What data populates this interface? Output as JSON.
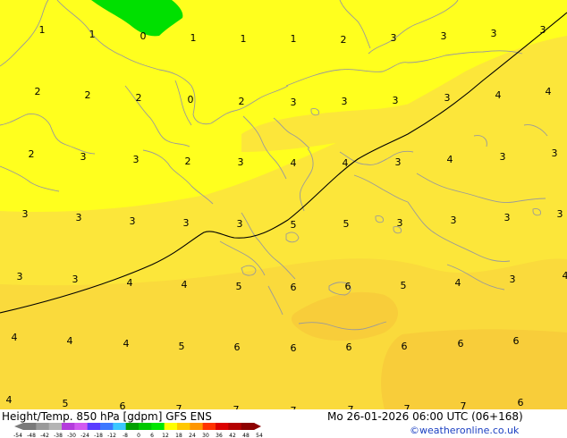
{
  "map": {
    "colors": {
      "base": "#ffff1e",
      "band_1": "#fce63a",
      "band_2": "#fada3c",
      "band_3": "#f8cd3a",
      "green_patch": "#00e000",
      "coast": "#9a9a9a",
      "contour": "#000000"
    },
    "values": [
      {
        "text": "1"
      },
      {
        "text": "1"
      },
      {
        "text": "0"
      },
      {
        "text": "1"
      },
      {
        "text": "1"
      },
      {
        "text": "1"
      },
      {
        "text": "2"
      },
      {
        "text": "3"
      },
      {
        "text": "3"
      },
      {
        "text": "3"
      },
      {
        "text": "3"
      },
      {
        "text": "2"
      },
      {
        "text": "2"
      },
      {
        "text": "2"
      },
      {
        "text": "0"
      },
      {
        "text": "2"
      },
      {
        "text": "3"
      },
      {
        "text": "3"
      },
      {
        "text": "3"
      },
      {
        "text": "3"
      },
      {
        "text": "4"
      },
      {
        "text": "4"
      },
      {
        "text": "2"
      },
      {
        "text": "3"
      },
      {
        "text": "3"
      },
      {
        "text": "2"
      },
      {
        "text": "3"
      },
      {
        "text": "4"
      },
      {
        "text": "4"
      },
      {
        "text": "3"
      },
      {
        "text": "4"
      },
      {
        "text": "3"
      },
      {
        "text": "3"
      },
      {
        "text": "3"
      },
      {
        "text": "3"
      },
      {
        "text": "3"
      },
      {
        "text": "3"
      },
      {
        "text": "3"
      },
      {
        "text": "5"
      },
      {
        "text": "5"
      },
      {
        "text": "3"
      },
      {
        "text": "3"
      },
      {
        "text": "3"
      },
      {
        "text": "3"
      },
      {
        "text": "3"
      },
      {
        "text": "3"
      },
      {
        "text": "4"
      },
      {
        "text": "4"
      },
      {
        "text": "5"
      },
      {
        "text": "6"
      },
      {
        "text": "6"
      },
      {
        "text": "5"
      },
      {
        "text": "4"
      },
      {
        "text": "3"
      },
      {
        "text": "4"
      },
      {
        "text": "4"
      },
      {
        "text": "4"
      },
      {
        "text": "4"
      },
      {
        "text": "5"
      },
      {
        "text": "6"
      },
      {
        "text": "6"
      },
      {
        "text": "6"
      },
      {
        "text": "6"
      },
      {
        "text": "6"
      },
      {
        "text": "6"
      },
      {
        "text": "4"
      },
      {
        "text": "5"
      },
      {
        "text": "6"
      },
      {
        "text": "7"
      },
      {
        "text": "7"
      },
      {
        "text": "7"
      },
      {
        "text": "7"
      },
      {
        "text": "7"
      },
      {
        "text": "7"
      },
      {
        "text": "6"
      }
    ]
  },
  "footer": {
    "title": "Height/Temp. 850 hPa [gdpm] GFS ENS",
    "datetime": "Mo 26-01-2026 06:00 UTC (06+168)",
    "credit": "©weatheronline.co.uk"
  },
  "legend": {
    "labels": [
      "-54",
      "-48",
      "-42",
      "-38",
      "-30",
      "-24",
      "-18",
      "-12",
      "-8",
      "0",
      "6",
      "12",
      "18",
      "24",
      "30",
      "36",
      "42",
      "48",
      "54"
    ],
    "colors": [
      "#7a7a7a",
      "#9a9a9a",
      "#b4b4b4",
      "#b43cdc",
      "#d25af0",
      "#5a3cff",
      "#3c78ff",
      "#3cc8ff",
      "#00a000",
      "#00c800",
      "#00e600",
      "#ffff00",
      "#ffc800",
      "#ff9600",
      "#ff3200",
      "#dc0000",
      "#b40000",
      "#8c0000"
    ]
  }
}
